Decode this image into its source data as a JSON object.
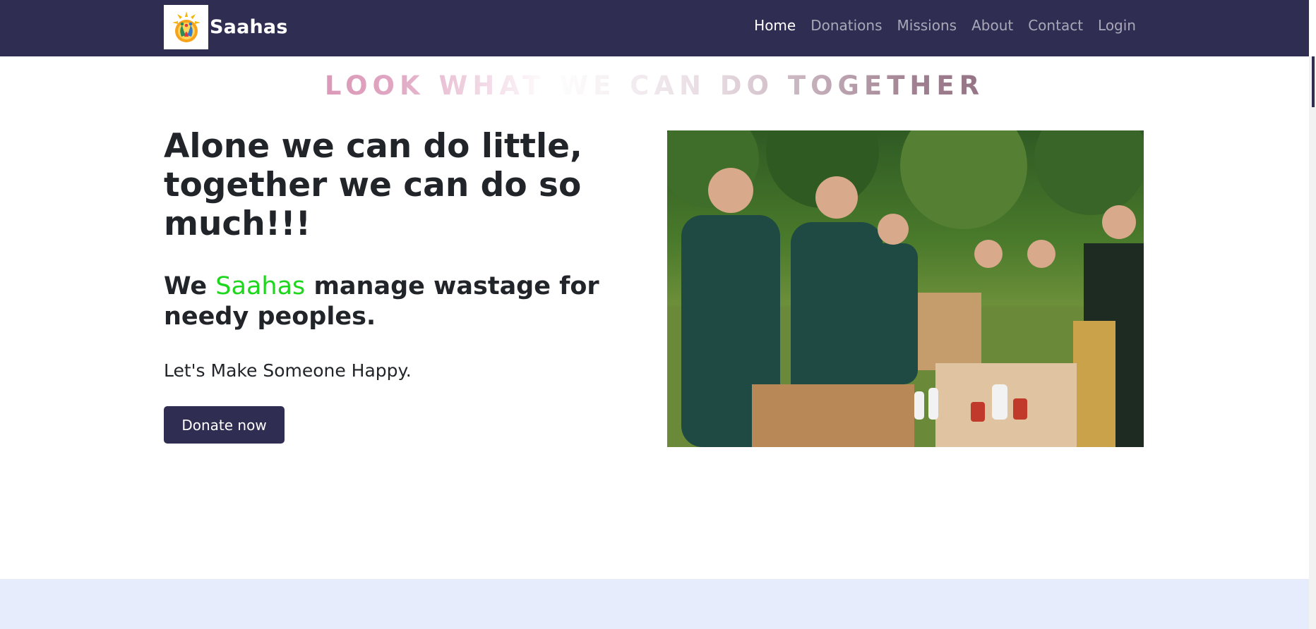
{
  "nav": {
    "brand": "Saahas",
    "links": [
      {
        "label": "Home",
        "active": true
      },
      {
        "label": "Donations",
        "active": false
      },
      {
        "label": "Missions",
        "active": false
      },
      {
        "label": "About",
        "active": false
      },
      {
        "label": "Contact",
        "active": false
      },
      {
        "label": "Login",
        "active": false
      }
    ]
  },
  "hero": {
    "tagline": "LOOK WHAT WE CAN DO TOGETHER",
    "heading": "Alone we can do little, together we can do so much!!!",
    "sub_prefix": "We ",
    "sub_highlight": "Saahas",
    "sub_suffix": " manage wastage for needy peoples.",
    "happy": "Let's Make Someone Happy.",
    "donate_button": "Donate now"
  },
  "colors": {
    "navbar": "#2f2d52",
    "highlight": "#1ed61e",
    "bottom_band": "#e6ecfb"
  },
  "icons": {
    "logo": "saahas-logo-icon"
  }
}
